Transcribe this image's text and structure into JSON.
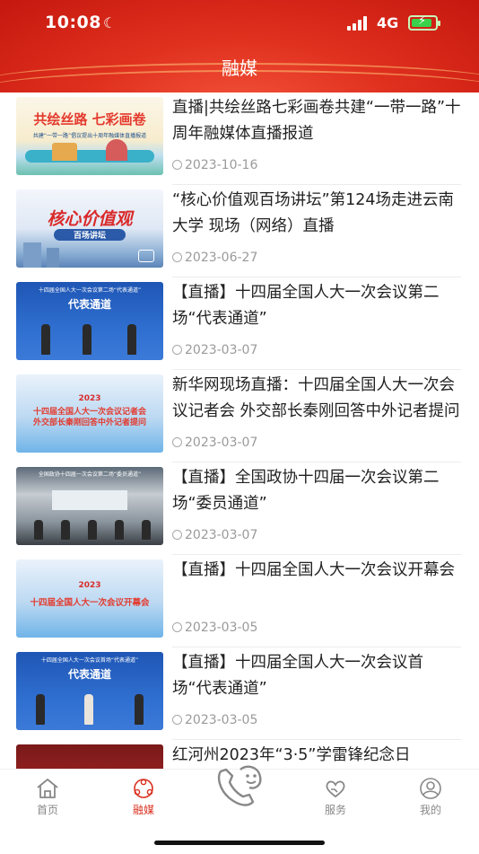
{
  "status_bar": {
    "time": "10:08",
    "network": "4G"
  },
  "header": {
    "title": "融媒"
  },
  "news": [
    {
      "title": "直播|共绘丝路七彩画卷共建“一带一路”十周年融媒体直播报道",
      "date": "2023-10-16"
    },
    {
      "title": "“核心价值观百场讲坛”第124场走进云南大学 现场（网络）直播",
      "date": "2023-06-27"
    },
    {
      "title": "【直播】十四届全国人大一次会议第二场“代表通道”",
      "date": "2023-03-07"
    },
    {
      "title": "新华网现场直播：十四届全国人大一次会议记者会 外交部长秦刚回答中外记者提问",
      "date": "2023-03-07"
    },
    {
      "title": "【直播】全国政协十四届一次会议第二场“委员通道”",
      "date": "2023-03-07"
    },
    {
      "title": "【直播】十四届全国人大一次会议开幕会",
      "date": "2023-03-05"
    },
    {
      "title": "【直播】十四届全国人大一次会议首场“代表通道”",
      "date": "2023-03-05"
    },
    {
      "title": "红河州2023年“3·5”学雷锋纪念日",
      "date": ""
    }
  ],
  "thumbnails": {
    "t1": {
      "text": "共绘丝路 七彩画卷",
      "sub": "共建“一带一路”倡议提出十周年融媒体直播报道"
    },
    "t2": {
      "text": "核心价值观",
      "sub": "百场讲坛"
    },
    "t3": {
      "text": "代表通道",
      "top": "十四届全国人大一次会议第二场“代表通道”"
    },
    "t4": {
      "year": "2023",
      "line1": "十四届全国人大一次会议记者会",
      "line2": "外交部长秦刚回答中外记者提问"
    },
    "t5": {
      "top": "全国政协十四届一次会议第二场“委员通道”"
    },
    "t6": {
      "year": "2023",
      "line1": "十四届全国人大一次会议开幕会"
    },
    "t7": {
      "text": "代表通道",
      "top": "十四届全国人大一次会议首场“代表通道”"
    }
  },
  "tabbar": {
    "tabs": [
      {
        "label": "首页",
        "icon": "home-icon"
      },
      {
        "label": "融媒",
        "icon": "media-icon"
      },
      {
        "label": "",
        "icon": "phone-smile-icon"
      },
      {
        "label": "服务",
        "icon": "heart-hand-icon"
      },
      {
        "label": "我的",
        "icon": "user-icon"
      }
    ],
    "active_color": "#d9301f"
  }
}
